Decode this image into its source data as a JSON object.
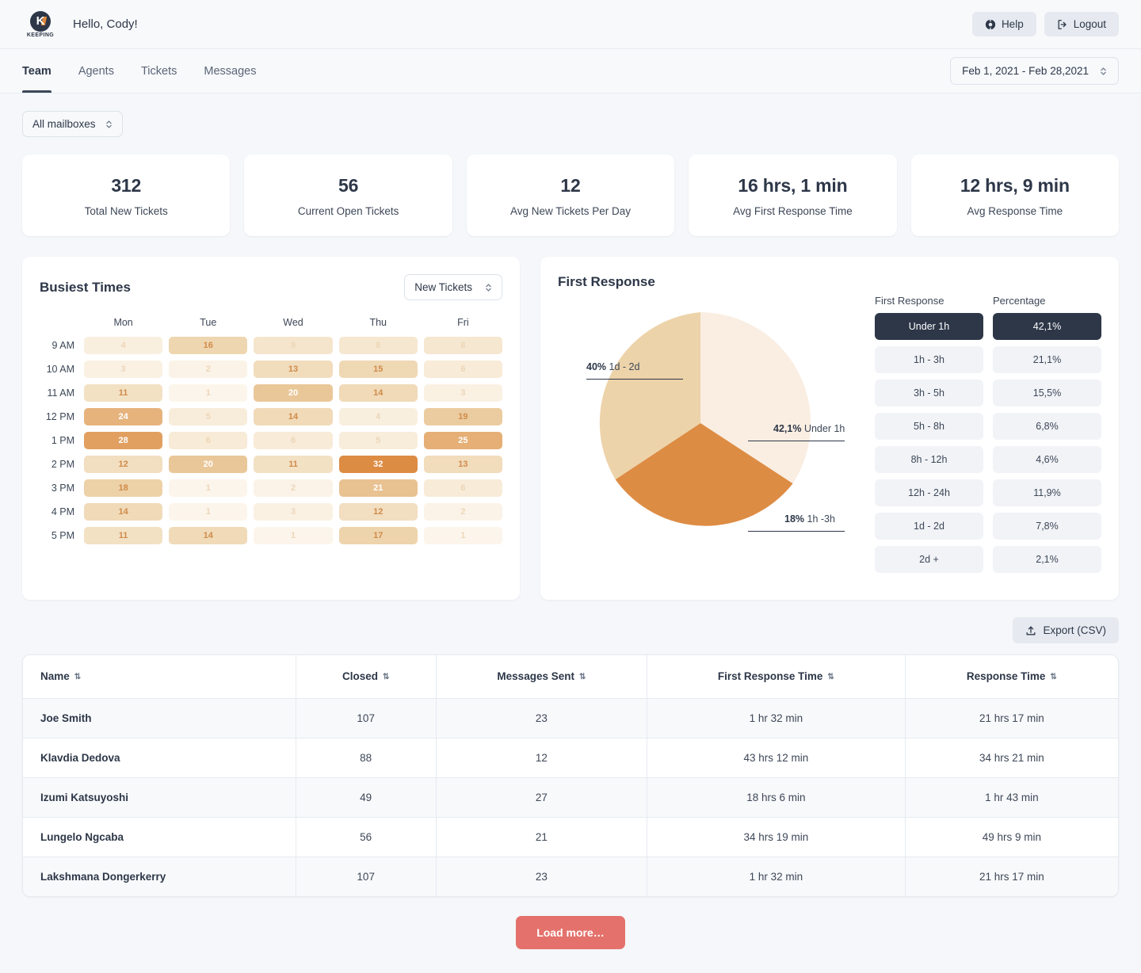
{
  "brand": {
    "name": "KEEPING",
    "mark": "K"
  },
  "header": {
    "greeting": "Hello, Cody!",
    "help_label": "Help",
    "logout_label": "Logout"
  },
  "nav": {
    "tabs": [
      {
        "label": "Team",
        "active": true
      },
      {
        "label": "Agents",
        "active": false
      },
      {
        "label": "Tickets",
        "active": false
      },
      {
        "label": "Messages",
        "active": false
      }
    ],
    "date_range": "Feb 1, 2021 - Feb 28,2021"
  },
  "filters": {
    "mailbox": "All mailboxes"
  },
  "stats": [
    {
      "value": "312",
      "label": "Total New Tickets"
    },
    {
      "value": "56",
      "label": "Current Open Tickets"
    },
    {
      "value": "12",
      "label": "Avg New Tickets Per Day"
    },
    {
      "value": "16 hrs, 1 min",
      "label": "Avg First Response Time"
    },
    {
      "value": "12 hrs, 9 min",
      "label": "Avg Response Time"
    }
  ],
  "busiest": {
    "title": "Busiest Times",
    "metric": "New Tickets",
    "days": [
      "Mon",
      "Tue",
      "Wed",
      "Thu",
      "Fri"
    ],
    "times": [
      "9 AM",
      "10 AM",
      "11 AM",
      "12 PM",
      "1 PM",
      "2 PM",
      "3 PM",
      "4 PM",
      "5 PM"
    ],
    "rows": [
      [
        4,
        16,
        9,
        8,
        8
      ],
      [
        3,
        2,
        13,
        15,
        6
      ],
      [
        11,
        1,
        20,
        14,
        3
      ],
      [
        24,
        5,
        14,
        4,
        19
      ],
      [
        28,
        6,
        6,
        5,
        25
      ],
      [
        12,
        20,
        11,
        32,
        13
      ],
      [
        18,
        1,
        2,
        21,
        6
      ],
      [
        14,
        1,
        3,
        12,
        2
      ],
      [
        11,
        14,
        1,
        17,
        1
      ]
    ],
    "max": 32
  },
  "first_response": {
    "title": "First Response",
    "col_label": "First Response",
    "col_pct": "Percentage",
    "buckets": [
      {
        "label": "Under 1h",
        "pct": "42,1%",
        "highlight": true
      },
      {
        "label": "1h - 3h",
        "pct": "21,1%",
        "highlight": false
      },
      {
        "label": "3h - 5h",
        "pct": "15,5%",
        "highlight": false
      },
      {
        "label": "5h - 8h",
        "pct": "6,8%",
        "highlight": false
      },
      {
        "label": "8h - 12h",
        "pct": "4,6%",
        "highlight": false
      },
      {
        "label": "12h - 24h",
        "pct": "11,9%",
        "highlight": false
      },
      {
        "label": "1d - 2d",
        "pct": "7,8%",
        "highlight": false
      },
      {
        "label": "2d +",
        "pct": "2,1%",
        "highlight": false
      }
    ],
    "pie_labels": {
      "top": {
        "pct": "40%",
        "name": "1d - 2d"
      },
      "right": {
        "pct": "42,1%",
        "name": "Under 1h"
      },
      "bottom": {
        "pct": "18%",
        "name": "1h -3h"
      }
    }
  },
  "chart_data": {
    "type": "pie",
    "title": "First Response",
    "labels": [
      "Under 1h",
      "1h -3h",
      "1d - 2d"
    ],
    "values": [
      42.1,
      18,
      40
    ],
    "display_values": [
      "42,1%",
      "18%",
      "40%"
    ],
    "colors": [
      "#faeee2",
      "#dd8c44",
      "#edd3aa"
    ],
    "legend": "callout-labels",
    "table": {
      "type": "table",
      "columns": [
        "First Response",
        "Percentage"
      ],
      "rows": [
        [
          "Under 1h",
          "42,1%"
        ],
        [
          "1h - 3h",
          "21,1%"
        ],
        [
          "3h - 5h",
          "15,5%"
        ],
        [
          "5h - 8h",
          "6,8%"
        ],
        [
          "8h - 12h",
          "4,6%"
        ],
        [
          "12h - 24h",
          "11,9%"
        ],
        [
          "1d - 2d",
          "7,8%"
        ],
        [
          "2d +",
          "2,1%"
        ]
      ]
    },
    "heatmap": {
      "type": "heatmap",
      "title": "Busiest Times",
      "xlabel": "",
      "ylabel": "",
      "categories_x": [
        "Mon",
        "Tue",
        "Wed",
        "Thu",
        "Fri"
      ],
      "categories_y": [
        "9 AM",
        "10 AM",
        "11 AM",
        "12 PM",
        "1 PM",
        "2 PM",
        "3 PM",
        "4 PM",
        "5 PM"
      ],
      "values": [
        [
          4,
          16,
          9,
          8,
          8
        ],
        [
          3,
          2,
          13,
          15,
          6
        ],
        [
          11,
          1,
          20,
          14,
          3
        ],
        [
          24,
          5,
          14,
          4,
          19
        ],
        [
          28,
          6,
          6,
          5,
          25
        ],
        [
          12,
          20,
          11,
          32,
          13
        ],
        [
          18,
          1,
          2,
          21,
          6
        ],
        [
          14,
          1,
          3,
          12,
          2
        ],
        [
          11,
          14,
          1,
          17,
          1
        ]
      ],
      "zmin": 1,
      "zmax": 32
    }
  },
  "export": {
    "label": "Export (CSV)"
  },
  "agents": {
    "columns": [
      "Name",
      "Closed",
      "Messages Sent",
      "First Response Time",
      "Response Time"
    ],
    "rows": [
      {
        "name": "Joe Smith",
        "closed": "107",
        "messages": "23",
        "first_response": "1 hr 32 min",
        "response": "21 hrs 17 min"
      },
      {
        "name": "Klavdia Dedova",
        "closed": "88",
        "messages": "12",
        "first_response": "43 hrs 12 min",
        "response": "34 hrs 21 min"
      },
      {
        "name": "Izumi Katsuyoshi",
        "closed": "49",
        "messages": "27",
        "first_response": "18 hrs 6 min",
        "response": "1 hr 43 min"
      },
      {
        "name": "Lungelo Ngcaba",
        "closed": "56",
        "messages": "21",
        "first_response": "34 hrs 19 min",
        "response": "49 hrs 9 min"
      },
      {
        "name": "Lakshmana Dongerkerry",
        "closed": "107",
        "messages": "23",
        "first_response": "1 hr 32 min",
        "response": "21 hrs 17 min"
      }
    ]
  },
  "load_more": {
    "label": "Load more…"
  },
  "colors": {
    "accent_orange": "#dd8c44",
    "pie_light": "#faeee2",
    "pie_tan": "#edd3aa",
    "dark": "#2d3748",
    "load_more": "#e4716b"
  }
}
